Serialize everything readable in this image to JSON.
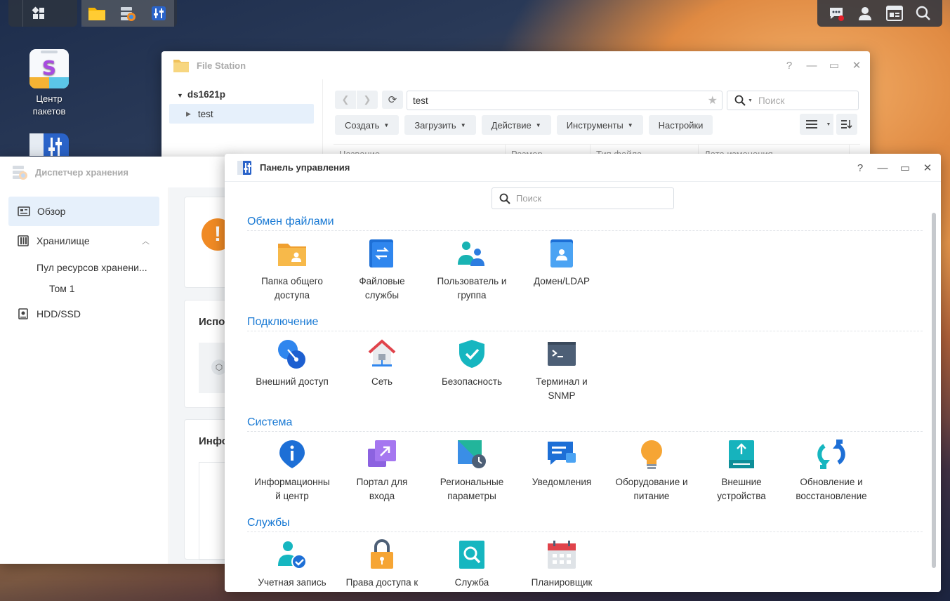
{
  "desktop": {
    "icons": [
      {
        "label_line1": "Центр",
        "label_line2": "пакетов",
        "icon": "package-center-icon"
      },
      {
        "label_line1": "",
        "label_line2": "",
        "icon": "control-panel-icon"
      }
    ]
  },
  "taskbar": {
    "left_apps": [
      "main-menu-icon",
      "file-station-icon",
      "storage-manager-icon",
      "control-panel-icon"
    ],
    "right_icons": [
      "notifications-icon",
      "user-icon",
      "widgets-icon",
      "search-icon"
    ]
  },
  "file_station": {
    "title": "File Station",
    "tree_root": "ds1621p",
    "tree_child": "test",
    "path_value": "test",
    "search_placeholder": "Поиск",
    "buttons": {
      "create": "Создать",
      "upload": "Загрузить",
      "action": "Действие",
      "tools": "Инструменты",
      "settings": "Настройки"
    },
    "columns": [
      "Название",
      "Размер",
      "Тип файла",
      "Дата изменения"
    ]
  },
  "storage_manager": {
    "title": "Диспетчер хранения",
    "nav": {
      "overview": "Обзор",
      "storage": "Хранилище",
      "pool": "Пул ресурсов хранени...",
      "volume": "Том 1",
      "hdd": "HDD/SSD"
    },
    "card2_title": "Испо",
    "card3_title": "Инфо"
  },
  "control_panel": {
    "title": "Панель управления",
    "search_placeholder": "Поиск",
    "sections": {
      "file_sharing": {
        "title": "Обмен файлами",
        "items": [
          {
            "l1": "Папка общего",
            "l2": "доступа"
          },
          {
            "l1": "Файловые",
            "l2": "службы"
          },
          {
            "l1": "Пользователь и",
            "l2": "группа"
          },
          {
            "l1": "Домен/LDAP",
            "l2": ""
          }
        ]
      },
      "connectivity": {
        "title": "Подключение",
        "items": [
          {
            "l1": "Внешний доступ",
            "l2": ""
          },
          {
            "l1": "Сеть",
            "l2": ""
          },
          {
            "l1": "Безопасность",
            "l2": ""
          },
          {
            "l1": "Терминал и",
            "l2": "SNMP"
          }
        ]
      },
      "system": {
        "title": "Система",
        "items": [
          {
            "l1": "Информационны",
            "l2": "й центр"
          },
          {
            "l1": "Портал для",
            "l2": "входа"
          },
          {
            "l1": "Региональные",
            "l2": "параметры"
          },
          {
            "l1": "Уведомления",
            "l2": ""
          },
          {
            "l1": "Оборудование и",
            "l2": "питание"
          },
          {
            "l1": "Внешние",
            "l2": "устройства"
          },
          {
            "l1": "Обновление и",
            "l2": "восстановление"
          }
        ]
      },
      "services": {
        "title": "Службы",
        "items": [
          {
            "l1": "Учетная запись",
            "l2": ""
          },
          {
            "l1": "Права доступа к",
            "l2": ""
          },
          {
            "l1": "Служба",
            "l2": ""
          },
          {
            "l1": "Планировщик",
            "l2": ""
          }
        ]
      }
    }
  }
}
